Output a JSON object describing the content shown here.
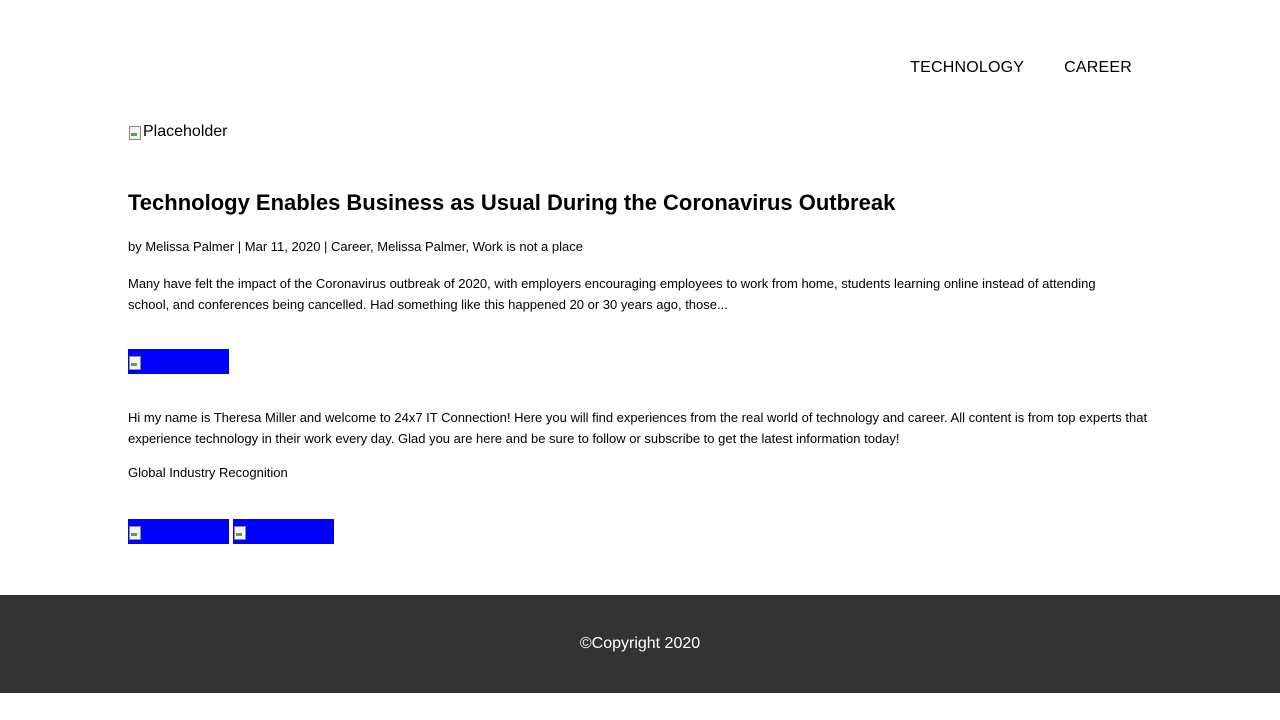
{
  "nav": {
    "items": [
      {
        "label": "TECHNOLOGY"
      },
      {
        "label": "CAREER"
      }
    ]
  },
  "hero": {
    "image_alt": "Placeholder"
  },
  "post": {
    "title": "Technology Enables Business as Usual During the Coronavirus Outbreak",
    "meta": "by Melissa Palmer | Mar 11, 2020 | Career, Melissa Palmer, Work is not a place",
    "excerpt": "Many have felt the impact of the Coronavirus outbreak of 2020, with employers encouraging employees to work from home, students learning online instead of attending school, and conferences being cancelled. Had something like this happened 20 or 30 years ago, those..."
  },
  "about": {
    "image_alt": "Placeholder",
    "text": "Hi my name is Theresa Miller and welcome to 24x7 IT Connection! Here you will find experiences from the real world of technology and career. All content is from top experts that experience technology in their work every day. Glad you are here and be sure to follow or subscribe to get the latest information today!"
  },
  "recognition": {
    "heading": "Global Industry Recognition",
    "badges": [
      {
        "image_alt": "Placeholder"
      },
      {
        "image_alt": "Placeholder"
      }
    ]
  },
  "footer": {
    "copyright": "©Copyright 2020"
  },
  "colors": {
    "link_bg": "#0000ff",
    "footer_bg": "#333333",
    "footer_text": "#ffffff"
  }
}
